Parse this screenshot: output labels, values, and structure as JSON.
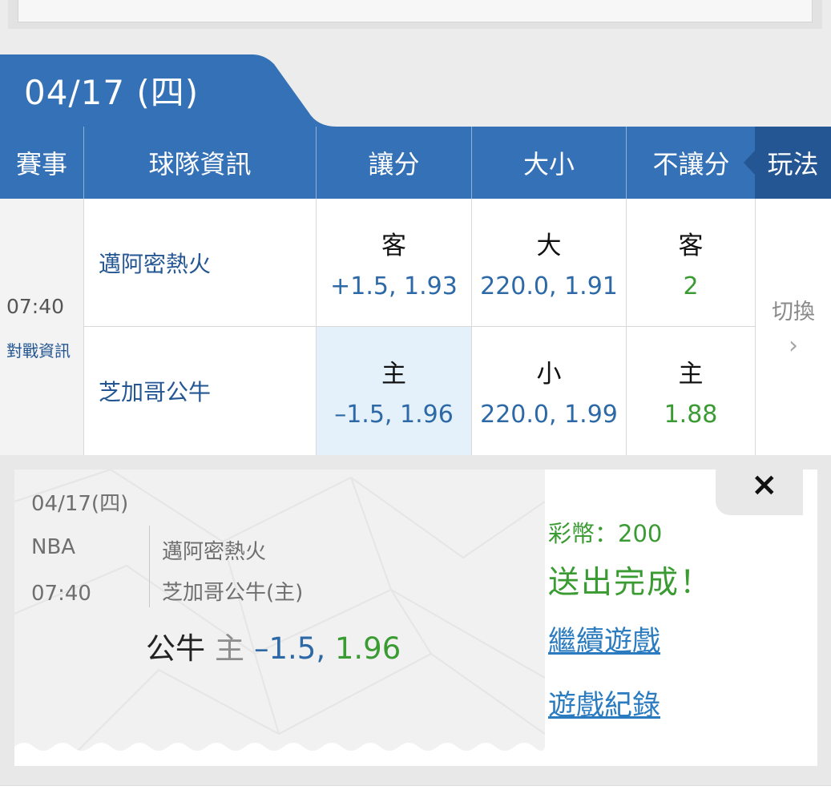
{
  "date_tab": {
    "label": "04/17 (四)"
  },
  "header": {
    "event": "賽事",
    "team_info": "球隊資訊",
    "spread": "讓分",
    "total": "大小",
    "moneyline": "不讓分",
    "play": "玩法"
  },
  "game": {
    "time": "07:40",
    "info_link": "對戰資訊",
    "away_team": "邁阿密熱火",
    "home_team": "芝加哥公牛",
    "spread": {
      "away": {
        "label": "客",
        "value": "+1.5, 1.93"
      },
      "home": {
        "label": "主",
        "value": "–1.5, 1.96"
      }
    },
    "total": {
      "over": {
        "label": "大",
        "value": "220.0, 1.91"
      },
      "under": {
        "label": "小",
        "value": "220.0, 1.99"
      }
    },
    "moneyline": {
      "away": {
        "label": "客",
        "value": "2"
      },
      "home": {
        "label": "主",
        "value": "1.88"
      }
    },
    "switch_label": "切換",
    "switch_arrow": "›"
  },
  "ticket": {
    "date": "04/17(四)",
    "league": "NBA",
    "time": "07:40",
    "away": "邁阿密熱火",
    "home": "芝加哥公牛(主)",
    "pick_team": "公牛",
    "pick_side": "主",
    "pick_line": "–1.5,",
    "pick_price": "1.96",
    "coins": "彩幣：200",
    "status": "送出完成！",
    "continue_link": "繼續遊戲",
    "history_link": "遊戲紀錄",
    "close": "×"
  },
  "colors": {
    "header_blue": "#3471b6",
    "play_blue": "#245693",
    "odds_blue": "#2c69a6",
    "odds_green": "#3b9b33",
    "selected_bg": "#e4f1fb",
    "link_blue": "#2a7bc0"
  }
}
